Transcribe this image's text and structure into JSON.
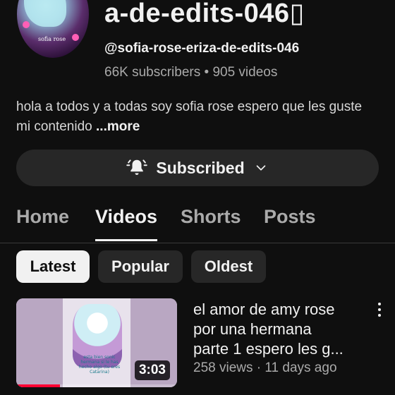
{
  "channel": {
    "title": "a-de-edits-046▯",
    "handle": "@sofia-rose-eriza-de-edits-046",
    "subscribers": "66K subscribers",
    "separator": "•",
    "videos": "905 videos",
    "description": "hola a todos y a todas soy sofia rose espero que les guste mi contenido",
    "more_label": "...more",
    "avatar_tag": "sofia rose"
  },
  "subscribe": {
    "label": "Subscribed",
    "icon": "bell-icon",
    "chevron": "chevron-down-icon"
  },
  "tabs": [
    {
      "label": "Home",
      "active": false
    },
    {
      "label": "Videos",
      "active": true
    },
    {
      "label": "Shorts",
      "active": false
    },
    {
      "label": "Posts",
      "active": false
    }
  ],
  "filters": [
    {
      "label": "Latest",
      "selected": true
    },
    {
      "label": "Popular",
      "selected": false
    },
    {
      "label": "Oldest",
      "selected": false
    }
  ],
  "video": {
    "title_lines": [
      "el amor de amy rose",
      "por una hermana",
      "parte 1 espero les g..."
    ],
    "duration": "3:03",
    "views": "258 views",
    "meta_separator": "·",
    "age": "11 days ago",
    "watch_progress_pct": 27,
    "thumb_caption": "esta bien sonic hermana si le has hecho algo (tu eres Catarina)"
  },
  "colors": {
    "background": "#0f0f0f",
    "surface": "#272727",
    "text": "#f1f1f1",
    "muted": "#aaaaaa",
    "progress": "#ff0033"
  }
}
